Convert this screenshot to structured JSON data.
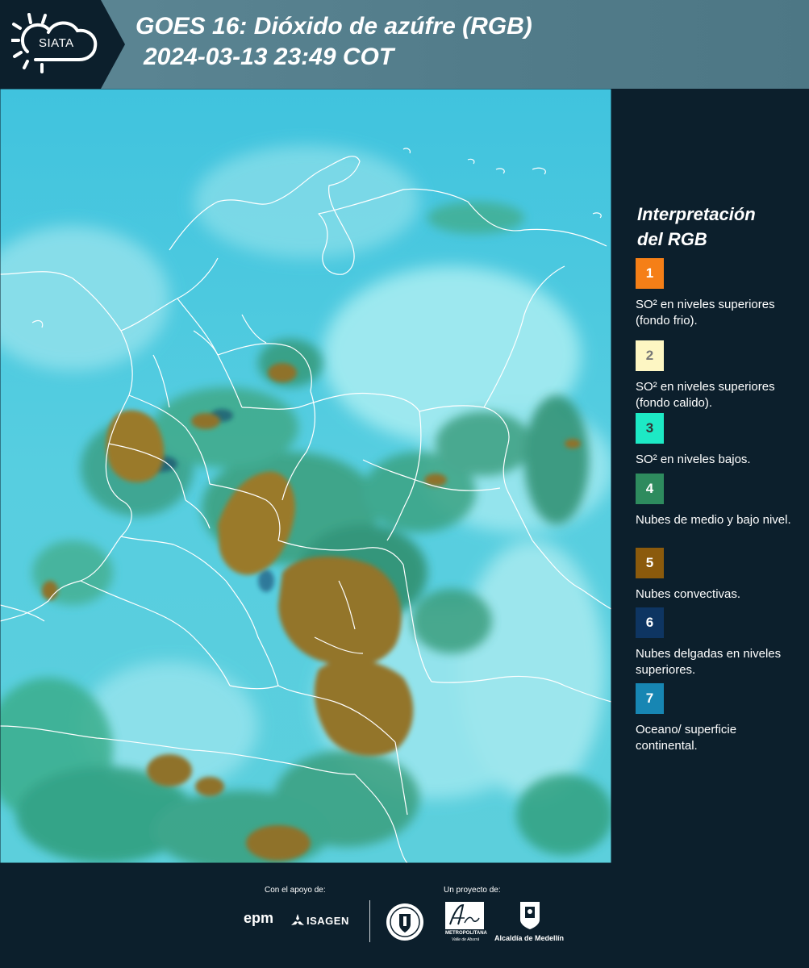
{
  "header": {
    "logo_text": "SIATA",
    "title_line1": "GOES 16: Dióxido de azúfre (RGB)",
    "title_line2": "2024-03-13 23:49 COT"
  },
  "legend": {
    "title_line1": "Interpretación",
    "title_line2": "del RGB",
    "items": [
      {
        "num": "1",
        "color": "#f57f17",
        "text_color": "#ffffff",
        "text": "SO² en niveles superiores (fondo frio)."
      },
      {
        "num": "2",
        "color": "#fdf6c3",
        "text_color": "#777777",
        "text": "SO² en niveles superiores (fondo calido)."
      },
      {
        "num": "3",
        "color": "#1de9c5",
        "text_color": "#333333",
        "text": "SO² en niveles bajos."
      },
      {
        "num": "4",
        "color": "#2e8b5e",
        "text_color": "#ffffff",
        "text": "Nubes de medio y bajo nivel."
      },
      {
        "num": "5",
        "color": "#8b5a0c",
        "text_color": "#ffffff",
        "text": "Nubes convectivas."
      },
      {
        "num": "6",
        "color": "#0e3562",
        "text_color": "#ffffff",
        "text": "Nubes delgadas en niveles superiores."
      },
      {
        "num": "7",
        "color": "#1786b3",
        "text_color": "#ffffff",
        "text": "Oceano/ superficie continental."
      }
    ]
  },
  "footer": {
    "support_label": "Con el apoyo de:",
    "project_label": "Un proyecto de:",
    "epm": "epm",
    "isagen": "ISAGEN",
    "metropolitana": "METROPOLITANA",
    "valle": "Valle de Aburrá",
    "alcaldia": "Alcaldía de Medellín"
  }
}
